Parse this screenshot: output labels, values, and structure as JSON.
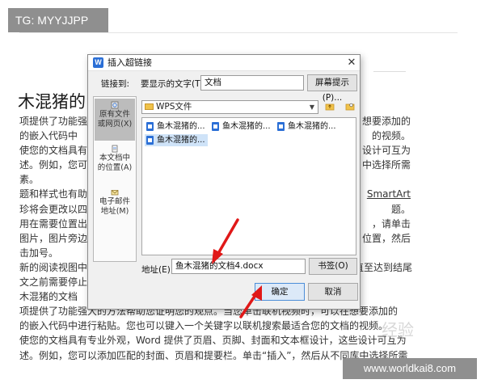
{
  "watermark": {
    "top_tag": "TG: MYYJJPP",
    "bottom_tag": "www.worldkai8.com",
    "jingyan": "经验"
  },
  "doc": {
    "heading": "木混猪的",
    "lines": [
      "项提供了功能强",
      "的嵌入代码中",
      "使您的文档具有",
      "述。例如，您可",
      "素。",
      "题和样式也有助",
      "珍将会更改以四",
      "用在需要位置出",
      "图片，图片旁边",
      "击加号。",
      "新的阅读视图中",
      "文之前需要停止读",
      "木混猪的文档",
      "项提供了功能强大的方法帮助您证明您的观点。当您单击联机视频时，可以在想要添加的",
      "的嵌入代码中进行粘贴。您也可以键入一个关键字以联机搜索最适合您的文档的视频。",
      "使您的文档具有专业外观，Word 提供了页眉、页脚、封面和文本框设计，这些设计可互为",
      "述。例如，您可以添加匹配的封面、页眉和提要栏。单击“插入”，然后从不同库中选择所需"
    ],
    "right_fragments": [
      "想要添加的",
      "的视频。",
      "设计可互为",
      "中选择所需",
      "",
      "SmartArt",
      "题。",
      "，请单击",
      "位置，然后",
      "",
      "直至达到结尾",
      "",
      "",
      "",
      "",
      "",
      ""
    ]
  },
  "dialog": {
    "title": "插入超链接",
    "close_glyph": "✕",
    "link_to_label": "链接到:",
    "display_text_label": "要显示的文字(T):",
    "display_text_value": "文档",
    "screen_tip_button": "屏幕提示(P)...",
    "link_panel": [
      {
        "label": "原有文件\n或网页(X)",
        "active": true
      },
      {
        "label": "本文档中\n的位置(A)",
        "active": false
      },
      {
        "label": "电子邮件\n地址(M)",
        "active": false
      }
    ],
    "folder": "WPS文件",
    "files": [
      "鱼木混猪的...",
      "鱼木混猪的...",
      "鱼木混猪的...",
      "鱼木混猪的..."
    ],
    "address_label": "地址(E):",
    "address_value": "鱼木混猪的文档4.docx",
    "bookmark_button": "书签(O)",
    "ok_button": "确定",
    "cancel_button": "取消"
  },
  "colors": {
    "accent": "#2b6fd6",
    "arrow": "#e01818",
    "selection": "#cfe3f8"
  }
}
